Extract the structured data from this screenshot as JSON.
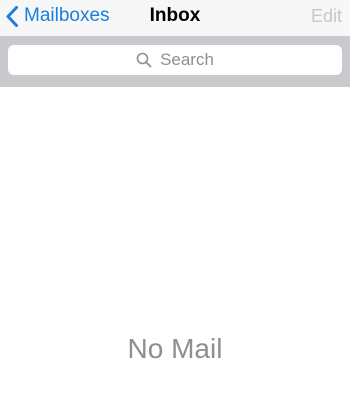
{
  "navbar": {
    "back_label": "Mailboxes",
    "title": "Inbox",
    "edit_label": "Edit"
  },
  "search": {
    "placeholder": "Search"
  },
  "content": {
    "empty_message": "No Mail"
  },
  "icons": {
    "back": "chevron-left-icon",
    "search": "search-icon"
  },
  "colors": {
    "accent": "#1a7fdc",
    "disabled": "#c7c7cc",
    "navbar_bg": "#f7f7f7",
    "search_area_bg": "#c9c9ce",
    "placeholder": "#8e8e93"
  }
}
